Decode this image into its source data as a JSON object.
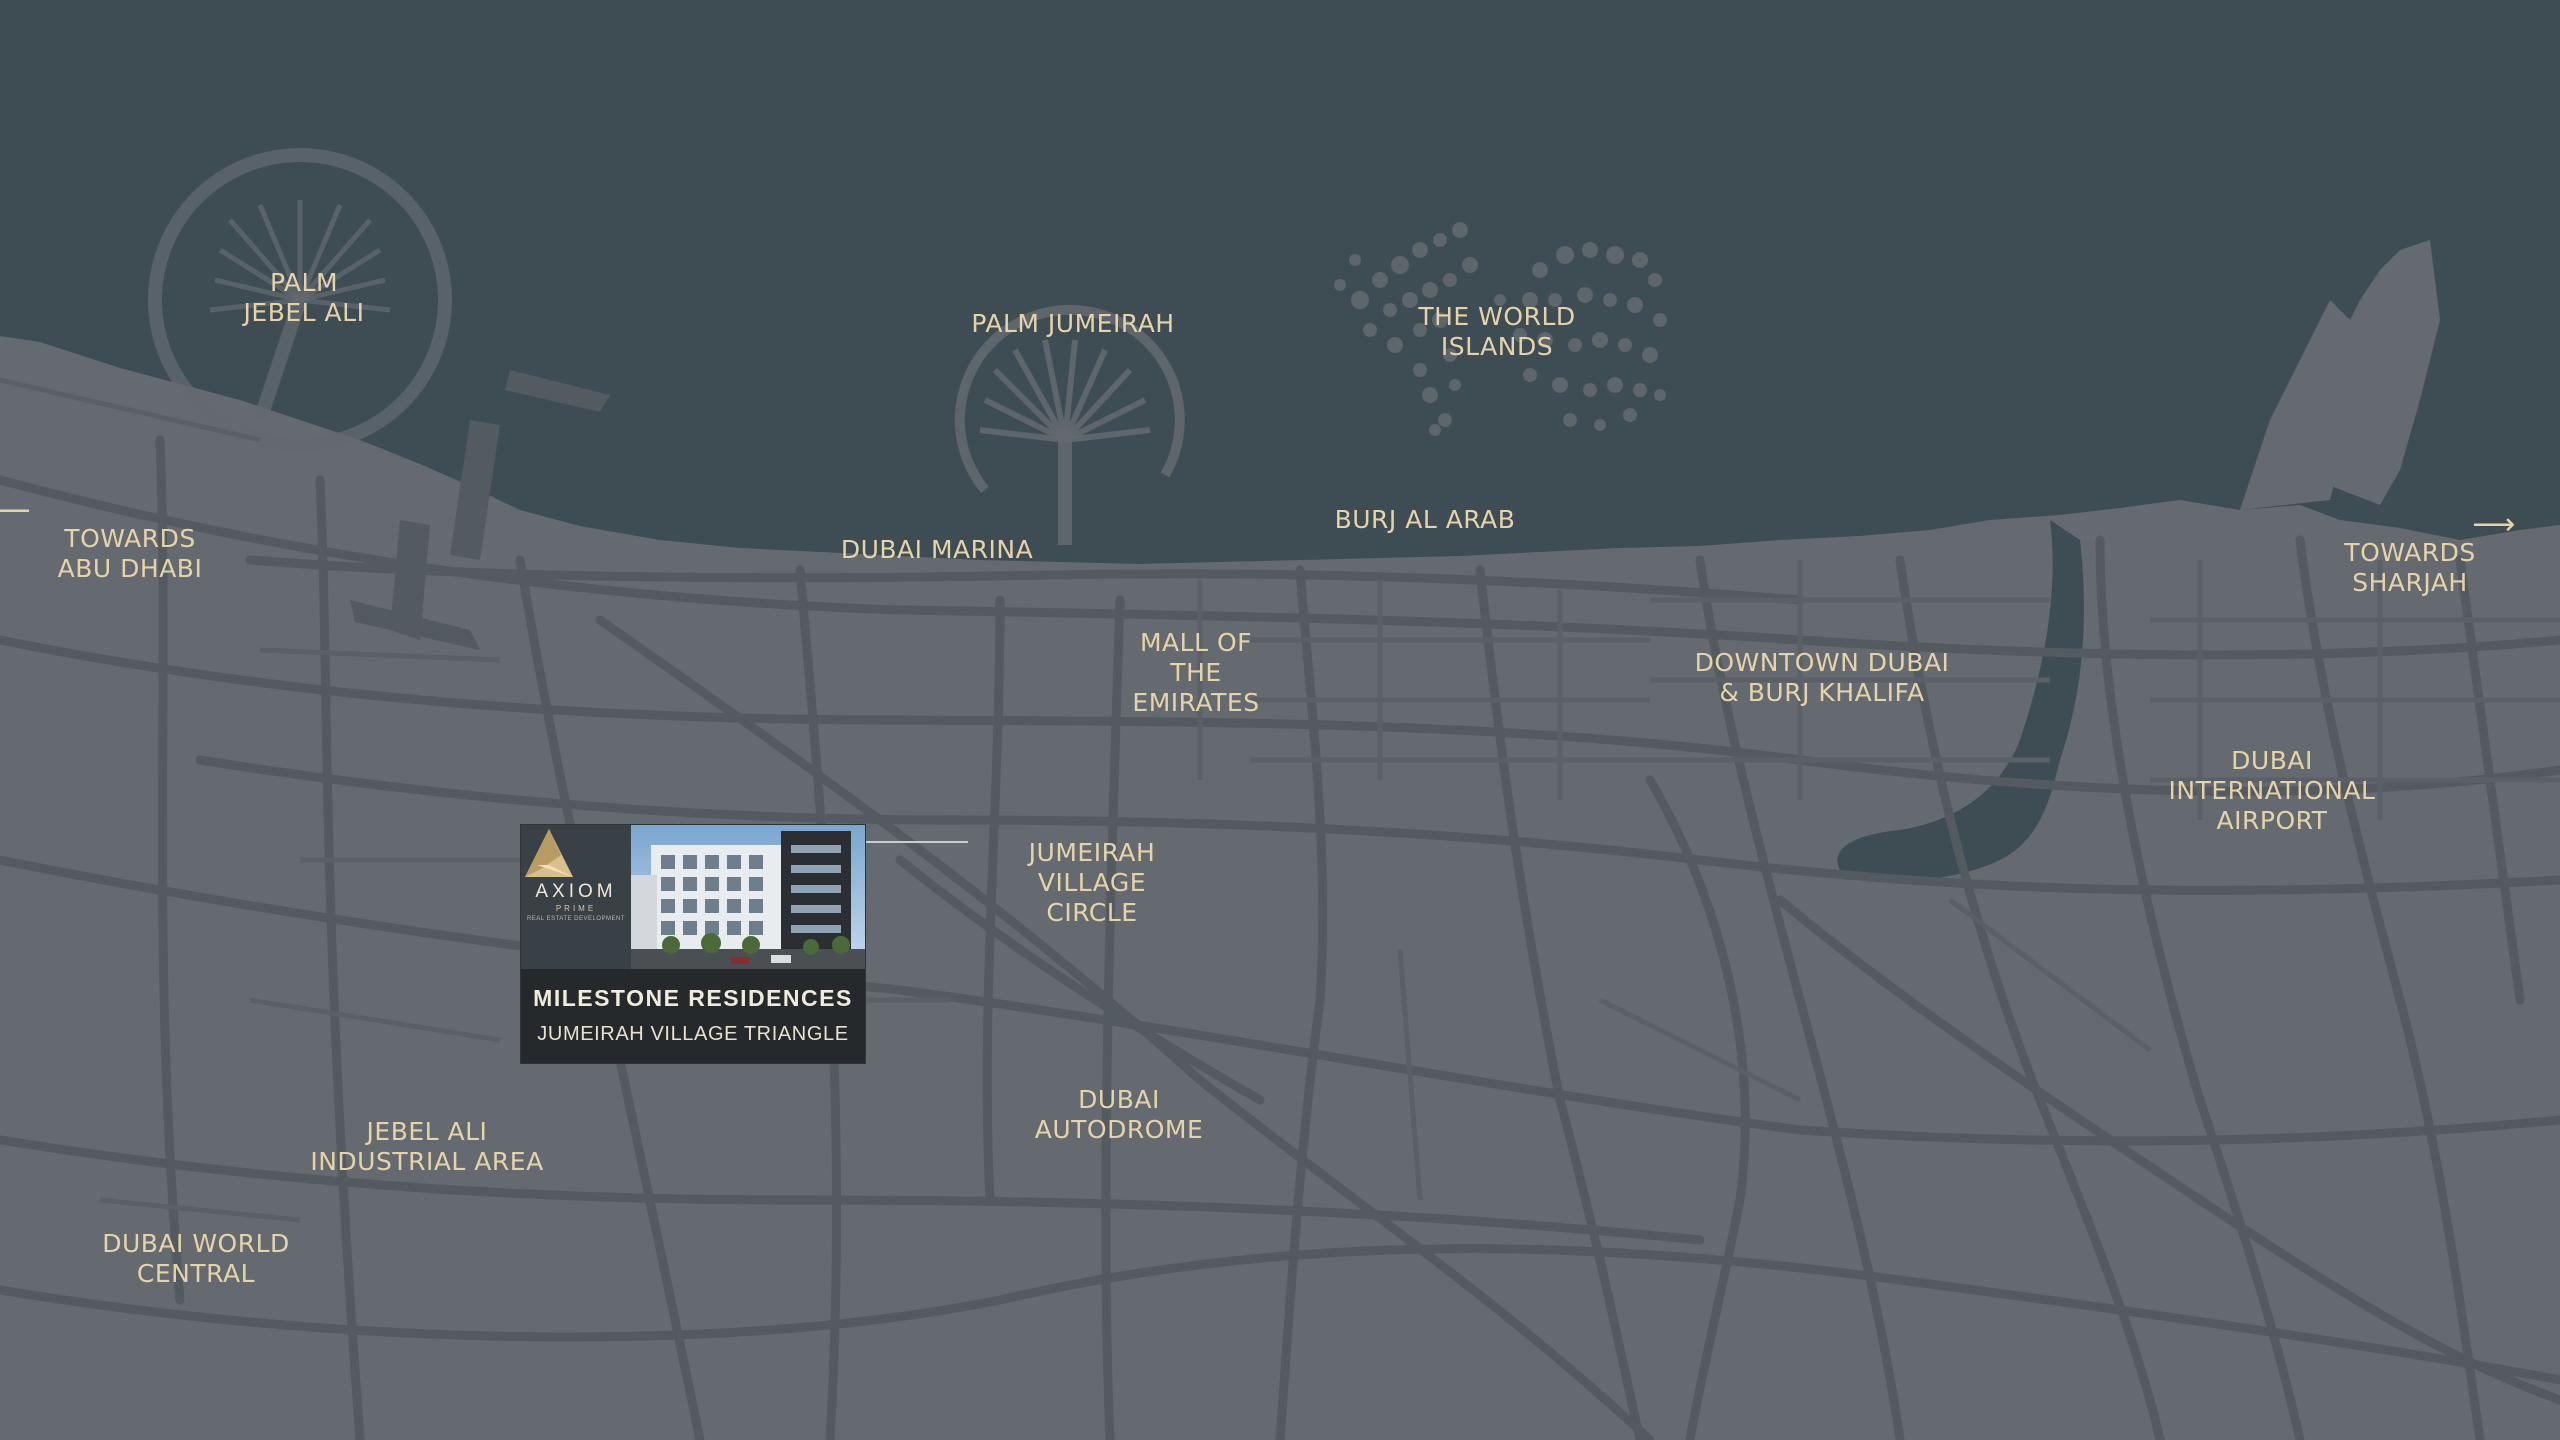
{
  "map": {
    "colors": {
      "sea": "#3e4c54",
      "land": "#646a70",
      "roads": "#535a60",
      "labels": "#e7d3a8"
    },
    "labels": [
      {
        "id": "palm-jebel-ali",
        "lines": [
          "PALM",
          "JEBEL ALI"
        ]
      },
      {
        "id": "palm-jumeirah",
        "lines": [
          "PALM JUMEIRAH"
        ]
      },
      {
        "id": "world-islands",
        "lines": [
          "THE WORLD",
          "ISLANDS"
        ]
      },
      {
        "id": "burj-al-arab",
        "lines": [
          "BURJ AL ARAB"
        ]
      },
      {
        "id": "dubai-marina",
        "lines": [
          "DUBAI MARINA"
        ]
      },
      {
        "id": "towards-abu-dhabi",
        "lines": [
          "TOWARDS",
          "ABU DHABI"
        ],
        "arrow": "⟵"
      },
      {
        "id": "towards-sharjah",
        "lines": [
          "TOWARDS",
          "SHARJAH"
        ],
        "arrow": "⟶"
      },
      {
        "id": "mall-of-emirates",
        "lines": [
          "MALL OF",
          "THE",
          "EMIRATES"
        ]
      },
      {
        "id": "downtown-dubai",
        "lines": [
          "DOWNTOWN DUBAI",
          "& BURJ KHALIFA"
        ]
      },
      {
        "id": "dubai-airport",
        "lines": [
          "DUBAI",
          "INTERNATIONAL",
          "AIRPORT"
        ]
      },
      {
        "id": "jvc",
        "lines": [
          "JUMEIRAH",
          "VILLAGE",
          "CIRCLE"
        ]
      },
      {
        "id": "dubai-autodrome",
        "lines": [
          "DUBAI",
          "AUTODROME"
        ]
      },
      {
        "id": "jebel-ali-industrial",
        "lines": [
          "JEBEL ALI",
          "INDUSTRIAL AREA"
        ]
      },
      {
        "id": "dubai-world-central",
        "lines": [
          "DUBAI WORLD",
          "CENTRAL"
        ]
      }
    ]
  },
  "card": {
    "brand": "AXIOM",
    "brand_sub": "PRIME",
    "brand_tag": "REAL ESTATE DEVELOPMENT",
    "title": "MILESTONE RESIDENCES",
    "subtitle": "JUMEIRAH VILLAGE TRIANGLE"
  }
}
